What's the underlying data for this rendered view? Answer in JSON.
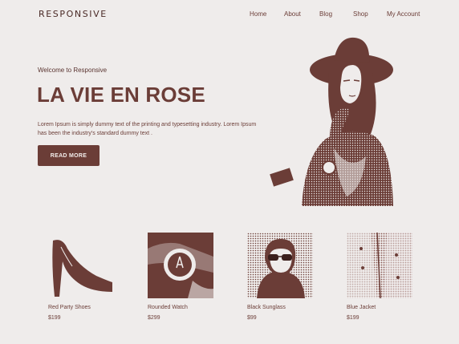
{
  "brand": {
    "logo_text": "RESPONSIVE"
  },
  "nav": {
    "items": [
      {
        "label": "Home"
      },
      {
        "label": "About"
      },
      {
        "label": "Blog"
      },
      {
        "label": "Shop"
      },
      {
        "label": "My Account"
      }
    ]
  },
  "hero": {
    "welcome": "Welcome to Responsive",
    "title": "LA VIE EN ROSE",
    "description": "Lorem Ipsum is simply dummy text of the printing and typesetting industry. Lorem Ipsum has been the industry's standard dummy text .",
    "button_label": "READ MORE"
  },
  "products": [
    {
      "name": "Red Party Shoes",
      "price": "$199"
    },
    {
      "name": "Rounded Watch",
      "price": "$299"
    },
    {
      "name": "Black Sunglass",
      "price": "$99"
    },
    {
      "name": "Blue Jacket",
      "price": "$199"
    }
  ],
  "colors": {
    "accent": "#6b3d37",
    "background": "#efeceb"
  }
}
